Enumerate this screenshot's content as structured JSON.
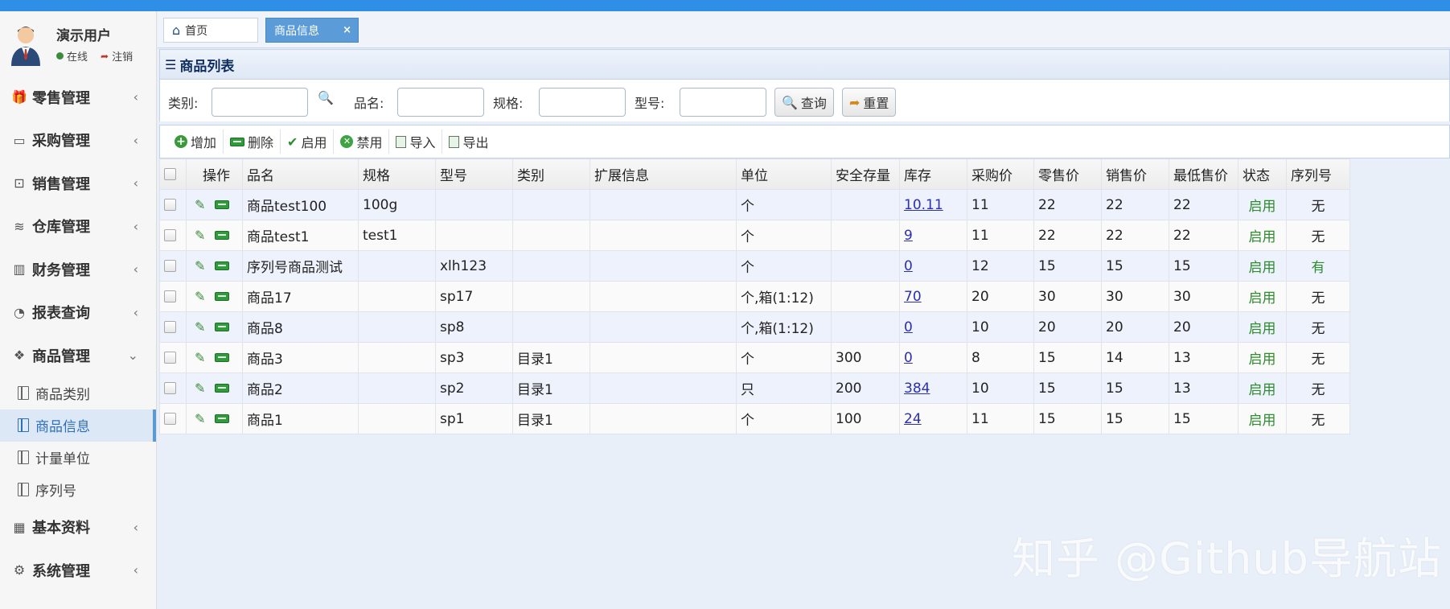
{
  "user": {
    "name": "演示用户",
    "status": "在线",
    "logout": "注销"
  },
  "menu": [
    {
      "label": "零售管理",
      "icon": "gift-icon",
      "glyph": "🎁"
    },
    {
      "label": "采购管理",
      "icon": "monitor-icon",
      "glyph": "▭"
    },
    {
      "label": "销售管理",
      "icon": "briefcase-icon",
      "glyph": "⊡"
    },
    {
      "label": "仓库管理",
      "icon": "layers-icon",
      "glyph": "≋"
    },
    {
      "label": "财务管理",
      "icon": "map-icon",
      "glyph": "▥"
    },
    {
      "label": "报表查询",
      "icon": "pie-chart-icon",
      "glyph": "◔"
    },
    {
      "label": "商品管理",
      "icon": "dropbox-icon",
      "glyph": "❖",
      "expanded": true
    },
    {
      "label": "基本资料",
      "icon": "grid-icon",
      "glyph": "▦"
    },
    {
      "label": "系统管理",
      "icon": "gear-icon",
      "glyph": "⚙"
    }
  ],
  "submenu": [
    {
      "label": "商品类别"
    },
    {
      "label": "商品信息",
      "active": true
    },
    {
      "label": "计量单位"
    },
    {
      "label": "序列号"
    }
  ],
  "tabs": {
    "home": "首页",
    "current": "商品信息",
    "close": "×"
  },
  "panel": {
    "title": "商品列表"
  },
  "search": {
    "category_label": "类别:",
    "name_label": "品名:",
    "spec_label": "规格:",
    "model_label": "型号:",
    "query_button": "查询",
    "reset_button": "重置"
  },
  "toolbar": {
    "add": "增加",
    "delete": "删除",
    "enable": "启用",
    "disable": "禁用",
    "import": "导入",
    "export": "导出"
  },
  "table": {
    "headers": [
      "操作",
      "品名",
      "规格",
      "型号",
      "类别",
      "扩展信息",
      "单位",
      "安全存量",
      "库存",
      "采购价",
      "零售价",
      "销售价",
      "最低售价",
      "状态",
      "序列号"
    ],
    "rows": [
      {
        "name": "商品test100",
        "spec": "100g",
        "model": "",
        "category": "",
        "ext": "",
        "unit": "个",
        "safety": "",
        "stock": "10.11",
        "purchase": "11",
        "retail": "22",
        "sale": "22",
        "min": "22",
        "status": "启用",
        "serial": "无"
      },
      {
        "name": "商品test1",
        "spec": "test1",
        "model": "",
        "category": "",
        "ext": "",
        "unit": "个",
        "safety": "",
        "stock": "9",
        "purchase": "11",
        "retail": "22",
        "sale": "22",
        "min": "22",
        "status": "启用",
        "serial": "无"
      },
      {
        "name": "序列号商品测试",
        "spec": "",
        "model": "xlh123",
        "category": "",
        "ext": "",
        "unit": "个",
        "safety": "",
        "stock": "0",
        "purchase": "12",
        "retail": "15",
        "sale": "15",
        "min": "15",
        "status": "启用",
        "serial": "有"
      },
      {
        "name": "商品17",
        "spec": "",
        "model": "sp17",
        "category": "",
        "ext": "",
        "unit": "个,箱(1:12)",
        "safety": "",
        "stock": "70",
        "purchase": "20",
        "retail": "30",
        "sale": "30",
        "min": "30",
        "status": "启用",
        "serial": "无"
      },
      {
        "name": "商品8",
        "spec": "",
        "model": "sp8",
        "category": "",
        "ext": "",
        "unit": "个,箱(1:12)",
        "safety": "",
        "stock": "0",
        "purchase": "10",
        "retail": "20",
        "sale": "20",
        "min": "20",
        "status": "启用",
        "serial": "无"
      },
      {
        "name": "商品3",
        "spec": "",
        "model": "sp3",
        "category": "目录1",
        "ext": "",
        "unit": "个",
        "safety": "300",
        "stock": "0",
        "purchase": "8",
        "retail": "15",
        "sale": "14",
        "min": "13",
        "status": "启用",
        "serial": "无"
      },
      {
        "name": "商品2",
        "spec": "",
        "model": "sp2",
        "category": "目录1",
        "ext": "",
        "unit": "只",
        "safety": "200",
        "stock": "384",
        "purchase": "10",
        "retail": "15",
        "sale": "15",
        "min": "13",
        "status": "启用",
        "serial": "无"
      },
      {
        "name": "商品1",
        "spec": "",
        "model": "sp1",
        "category": "目录1",
        "ext": "",
        "unit": "个",
        "safety": "100",
        "stock": "24",
        "purchase": "11",
        "retail": "15",
        "sale": "15",
        "min": "15",
        "status": "启用",
        "serial": "无"
      }
    ]
  },
  "watermark": "知乎 @Github导航站",
  "colors": {
    "topbar": "#2f8ee6",
    "active_tab": "#5a9bd8",
    "enabled_green": "#2e8c2e",
    "link_blue": "#2b2fb0"
  }
}
